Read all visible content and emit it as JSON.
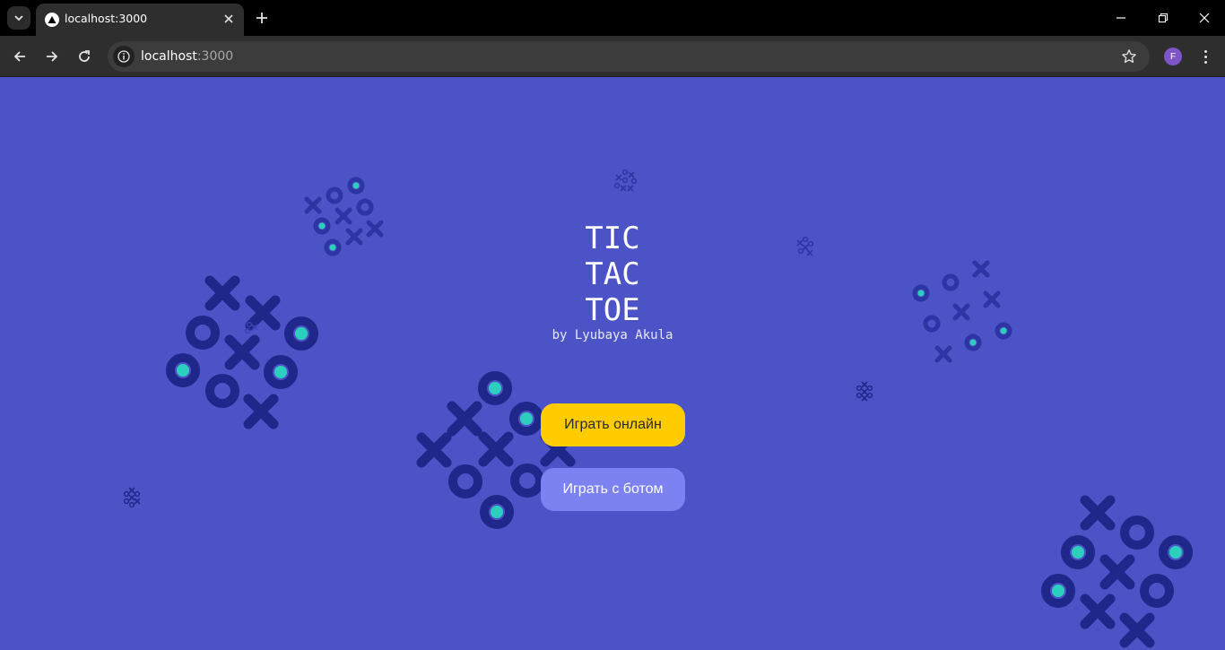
{
  "browser": {
    "tab_title": "localhost:3000",
    "url_host": "localhost",
    "url_port": ":3000",
    "profile_initial": "F"
  },
  "page": {
    "title_line1": "TIC",
    "title_line2": "TAC",
    "title_line3": "TOE",
    "subtitle": "by Lyubaya Akula",
    "play_online_label": "Играть онлайн",
    "play_bot_label": "Играть с ботом"
  },
  "colors": {
    "background": "#4c53c6",
    "accent_yellow": "#ffcc00",
    "secondary_button": "#7c82f1",
    "shape_dark": "#1f278a",
    "shape_teal": "#2ccfbd"
  }
}
